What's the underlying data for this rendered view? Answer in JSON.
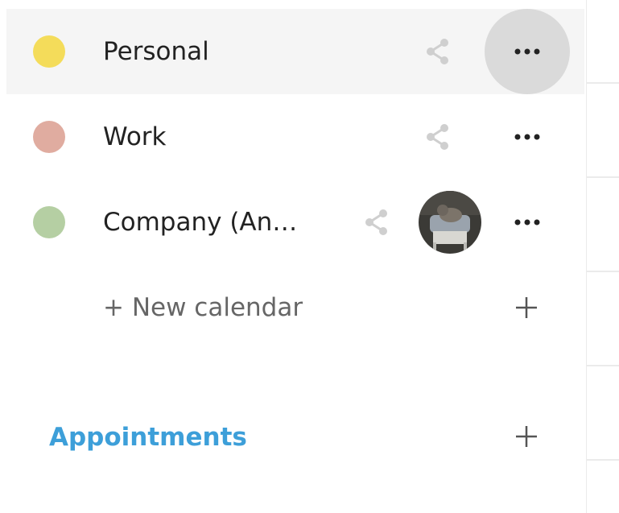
{
  "calendars": [
    {
      "name": "Personal",
      "color": "#f4dc5a",
      "active": true,
      "shared_with_avatar": false
    },
    {
      "name": "Work",
      "color": "#e0aca0",
      "active": false,
      "shared_with_avatar": false
    },
    {
      "name": "Company (An…",
      "color": "#b5cfa3",
      "active": false,
      "shared_with_avatar": true
    }
  ],
  "new_calendar": {
    "label": "+ New calendar",
    "icon": "plus-icon"
  },
  "appointments": {
    "label": "Appointments",
    "color": "#3d9fd9",
    "icon": "plus-icon"
  },
  "icons": {
    "share": "share-icon",
    "more": "more-horizontal-icon",
    "avatar": "user-avatar"
  }
}
